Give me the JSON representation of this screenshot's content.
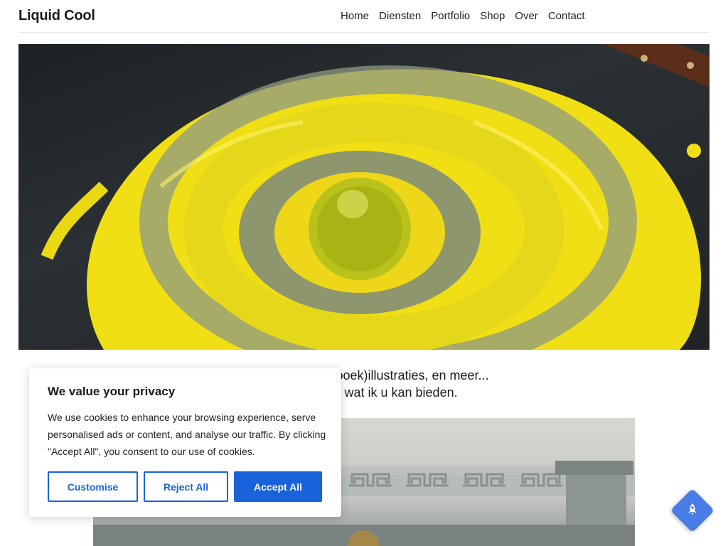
{
  "header": {
    "logo": "Liquid Cool",
    "nav": [
      "Home",
      "Diensten",
      "Portfolio",
      "Shop",
      "Over",
      "Contact"
    ]
  },
  "intro": {
    "line1": "en, schilderijen, (boek)illustraties, en meer...",
    "line2": "te en ontdek wat ik u kan bieden."
  },
  "cookie_banner": {
    "title": "We value your privacy",
    "text": "We use cookies to enhance your browsing experience, serve personalised ads or content, and analyse our traffic. By clicking \"Accept All\", you consent to our use of cookies.",
    "customise_label": "Customise",
    "reject_label": "Reject All",
    "accept_label": "Accept All"
  },
  "colors": {
    "accent": "#1863dc",
    "paint_yellow": "#f2e21a",
    "scroll_button": "#4a7ce8"
  },
  "icons": {
    "scroll_top": "rocket-icon"
  }
}
